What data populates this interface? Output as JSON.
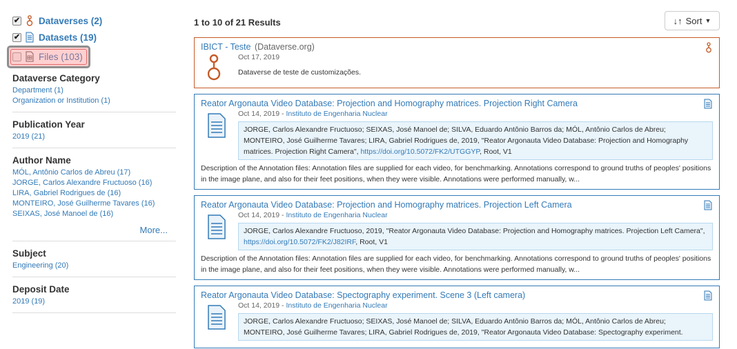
{
  "facets": {
    "types": [
      {
        "label": "Dataverses (2)",
        "checked": true
      },
      {
        "label": "Datasets (19)",
        "checked": true
      },
      {
        "label": "Files (103)",
        "checked": false
      }
    ],
    "groups": [
      {
        "title": "Dataverse Category",
        "items": [
          "Department (1)",
          "Organization or Institution (1)"
        ]
      },
      {
        "title": "Publication Year",
        "items": [
          "2019 (21)"
        ]
      },
      {
        "title": "Author Name",
        "items": [
          "MÓL, Antônio Carlos de Abreu (17)",
          "JORGE, Carlos Alexandre Fructuoso (16)",
          "LIRA, Gabriel Rodrigues de (16)",
          "MONTEIRO, José Guilherme Tavares (16)",
          "SEIXAS, José Manoel de (16)"
        ],
        "more": "More..."
      },
      {
        "title": "Subject",
        "items": [
          "Engineering (20)"
        ]
      },
      {
        "title": "Deposit Date",
        "items": [
          "2019 (19)"
        ]
      }
    ]
  },
  "results": {
    "count": "1 to 10 of 21 Results",
    "sort_label": "Sort",
    "dataverse": {
      "title": "IBICT - Teste",
      "subtitle": "(Dataverse.org)",
      "date": "Oct 17, 2019",
      "description": "Dataverse de teste de customizações."
    },
    "datasets": [
      {
        "title": "Reator Argonauta Video Database: Projection and Homography matrices. Projection Right Camera",
        "date": "Oct 14, 2019",
        "publisher": "Instituto de Engenharia Nuclear",
        "citation": "JORGE, Carlos Alexandre Fructuoso; SEIXAS, José Manoel de; SILVA, Eduardo Antônio Barros da; MÓL, Antônio Carlos de Abreu; MONTEIRO, José Guilherme Tavares; LIRA, Gabriel Rodrigues de, 2019, \"Reator Argonauta Video Database: Projection and Homography matrices. Projection Right Camera\",",
        "doi": "https://doi.org/10.5072/FK2/UTGGYP",
        "citation_tail": ", Root, V1",
        "description": "Description of the Annotation files: Annotation files are supplied for each video, for benchmarking. Annotations correspond to ground truths of peoples' positions in the image plane, and also for their feet positions, when they were visible. Annotations were performed manually, w..."
      },
      {
        "title": "Reator Argonauta Video Database: Projection and Homography matrices. Projection Left Camera",
        "date": "Oct 14, 2019",
        "publisher": "Instituto de Engenharia Nuclear",
        "citation": "JORGE, Carlos Alexandre Fructuoso, 2019, \"Reator Argonauta Video Database: Projection and Homography matrices. Projection Left Camera\",",
        "doi": "https://doi.org/10.5072/FK2/J82IRF",
        "citation_tail": ", Root, V1",
        "description": "Description of the Annotation files: Annotation files are supplied for each video, for benchmarking. Annotations correspond to ground truths of peoples' positions in the image plane, and also for their feet positions, when they were visible. Annotations were performed manually, w..."
      },
      {
        "title": "Reator Argonauta Video Database: Spectography experiment. Scene 3 (Left camera)",
        "date": "Oct 14, 2019",
        "publisher": "Instituto de Engenharia Nuclear",
        "citation": "JORGE, Carlos Alexandre Fructuoso; SEIXAS, José Manoel de; SILVA, Eduardo Antônio Barros da; MÓL, Antônio Carlos de Abreu; MONTEIRO, José Guilherme Tavares; LIRA, Gabriel Rodrigues de, 2019, \"Reator Argonauta Video Database: Spectography experiment.",
        "doi": "",
        "citation_tail": "",
        "description": ""
      }
    ]
  },
  "icons": {
    "dataverse": "dataverse-icon",
    "dataset": "dataset-icon",
    "file": "file-icon",
    "sort": "sort-icon",
    "checkmark": "check-icon"
  },
  "colors": {
    "link": "#337ab7",
    "dataverse_border": "#c55b28",
    "dataset_border": "#337ab7",
    "citation_bg": "#e9f4fb",
    "highlight": "#e36b6b"
  }
}
